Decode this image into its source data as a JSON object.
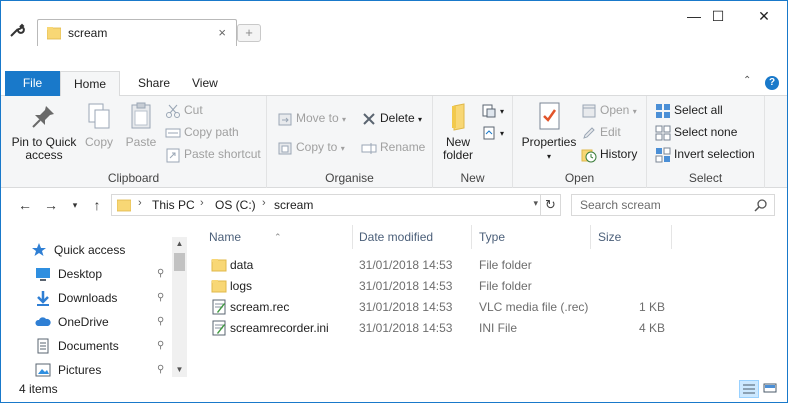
{
  "window": {
    "tab_title": "scream",
    "tab_close": "×",
    "new_tab": "+",
    "minimize": "—",
    "maximize": "☐",
    "close": "✕"
  },
  "ribbon_tabs": [
    "File",
    "Home",
    "Share",
    "View"
  ],
  "ribbon": {
    "clipboard": {
      "label": "Clipboard",
      "pin": "Pin to Quick access",
      "copy": "Copy",
      "paste": "Paste",
      "cut": "Cut",
      "copy_path": "Copy path",
      "paste_shortcut": "Paste shortcut"
    },
    "organise": {
      "label": "Organise",
      "move_to": "Move to",
      "copy_to": "Copy to",
      "delete": "Delete",
      "rename": "Rename"
    },
    "new": {
      "label": "New",
      "new_folder": "New folder"
    },
    "open": {
      "label": "Open",
      "properties": "Properties",
      "open": "Open",
      "edit": "Edit",
      "history": "History"
    },
    "select": {
      "label": "Select",
      "select_all": "Select all",
      "select_none": "Select none",
      "invert": "Invert selection"
    }
  },
  "address": {
    "crumbs": [
      "This PC",
      "OS (C:)",
      "scream"
    ],
    "search_placeholder": "Search scream"
  },
  "nav_pane": {
    "items": [
      {
        "label": "Quick access",
        "icon": "star-icon"
      },
      {
        "label": "Desktop",
        "icon": "desktop-icon"
      },
      {
        "label": "Downloads",
        "icon": "download-icon"
      },
      {
        "label": "OneDrive",
        "icon": "cloud-icon"
      },
      {
        "label": "Documents",
        "icon": "document-icon"
      },
      {
        "label": "Pictures",
        "icon": "picture-icon"
      }
    ],
    "pin_glyph": "📌"
  },
  "file_list": {
    "columns": [
      "Name",
      "Date modified",
      "Type",
      "Size"
    ],
    "rows": [
      {
        "name": "data",
        "date": "31/01/2018 14:53",
        "type": "File folder",
        "size": "",
        "icon": "folder-icon"
      },
      {
        "name": "logs",
        "date": "31/01/2018 14:53",
        "type": "File folder",
        "size": "",
        "icon": "folder-icon"
      },
      {
        "name": "scream.rec",
        "date": "31/01/2018 14:53",
        "type": "VLC media file (.rec)",
        "size": "1 KB",
        "icon": "text-file-icon"
      },
      {
        "name": "screamrecorder.ini",
        "date": "31/01/2018 14:53",
        "type": "INI File",
        "size": "4 KB",
        "icon": "ini-file-icon"
      }
    ]
  },
  "status": {
    "count": "4 items"
  },
  "colors": {
    "accent": "#1979ca",
    "folder": "#f8d775",
    "ribbon_bg": "#f5f6f7"
  }
}
